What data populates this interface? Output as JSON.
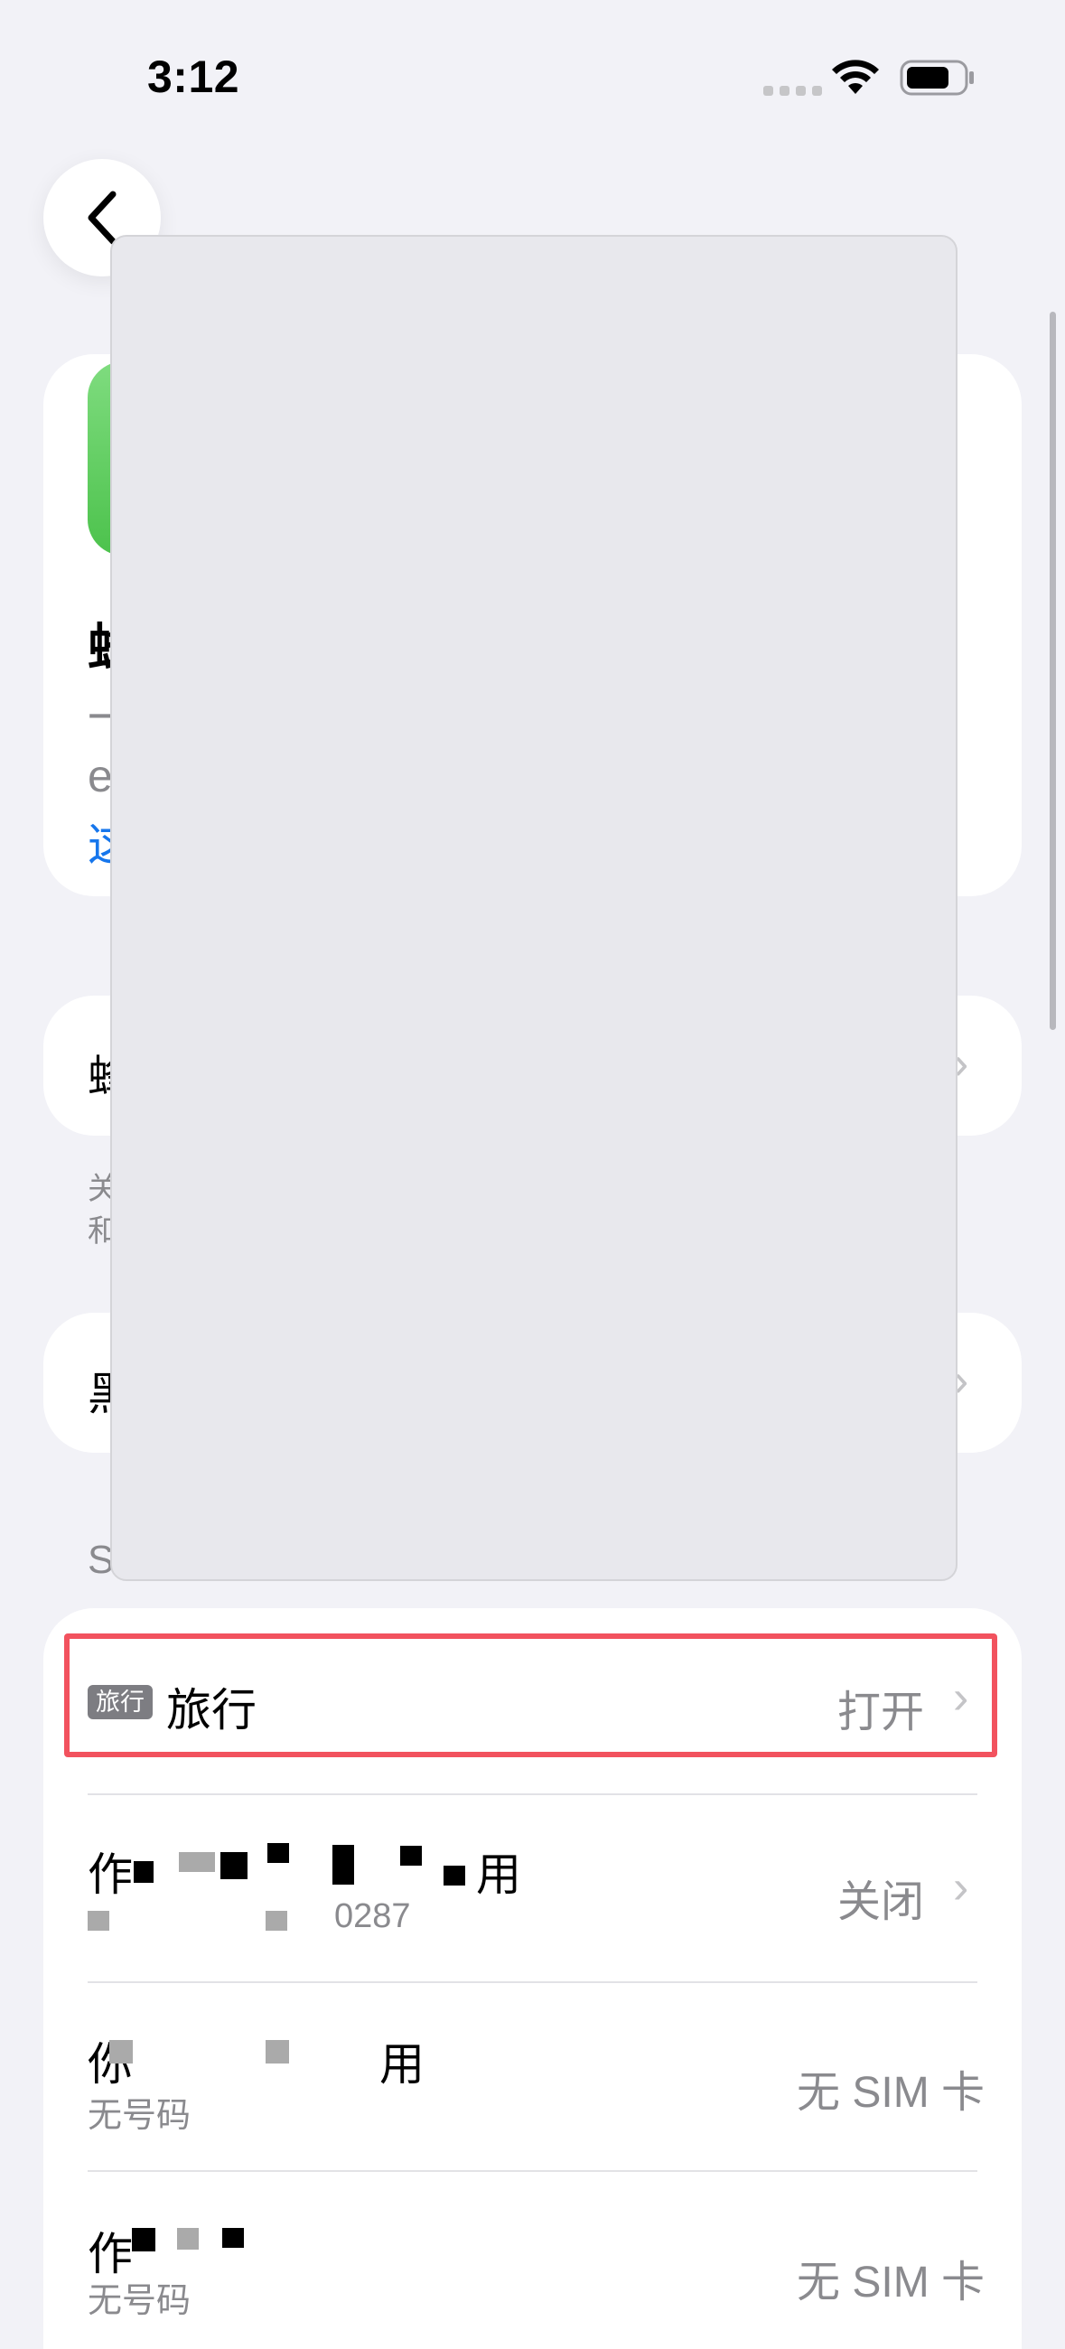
{
  "status_bar": {
    "time": "3:12"
  },
  "hero": {
    "title_fragment": "蜂",
    "line1_fragment": "一",
    "line2_fragment": "e",
    "link_fragment": "这"
  },
  "rows_top": [
    {
      "label_fragment": "蜂"
    },
    {
      "label_fragment": "黑"
    }
  ],
  "footnote": {
    "line1": "关",
    "line2": "和"
  },
  "section_header": "S",
  "sim_rows": [
    {
      "tag": "旅行",
      "title": "旅行",
      "value": "打开"
    },
    {
      "title": "作",
      "title_end": "用",
      "subtitle": "0287",
      "value": "关闭"
    },
    {
      "title": "你",
      "title_end": "用",
      "subtitle": "无号码",
      "value": "无 SIM 卡"
    },
    {
      "title": "作",
      "subtitle": "无号码",
      "value": "无 SIM 卡"
    }
  ]
}
